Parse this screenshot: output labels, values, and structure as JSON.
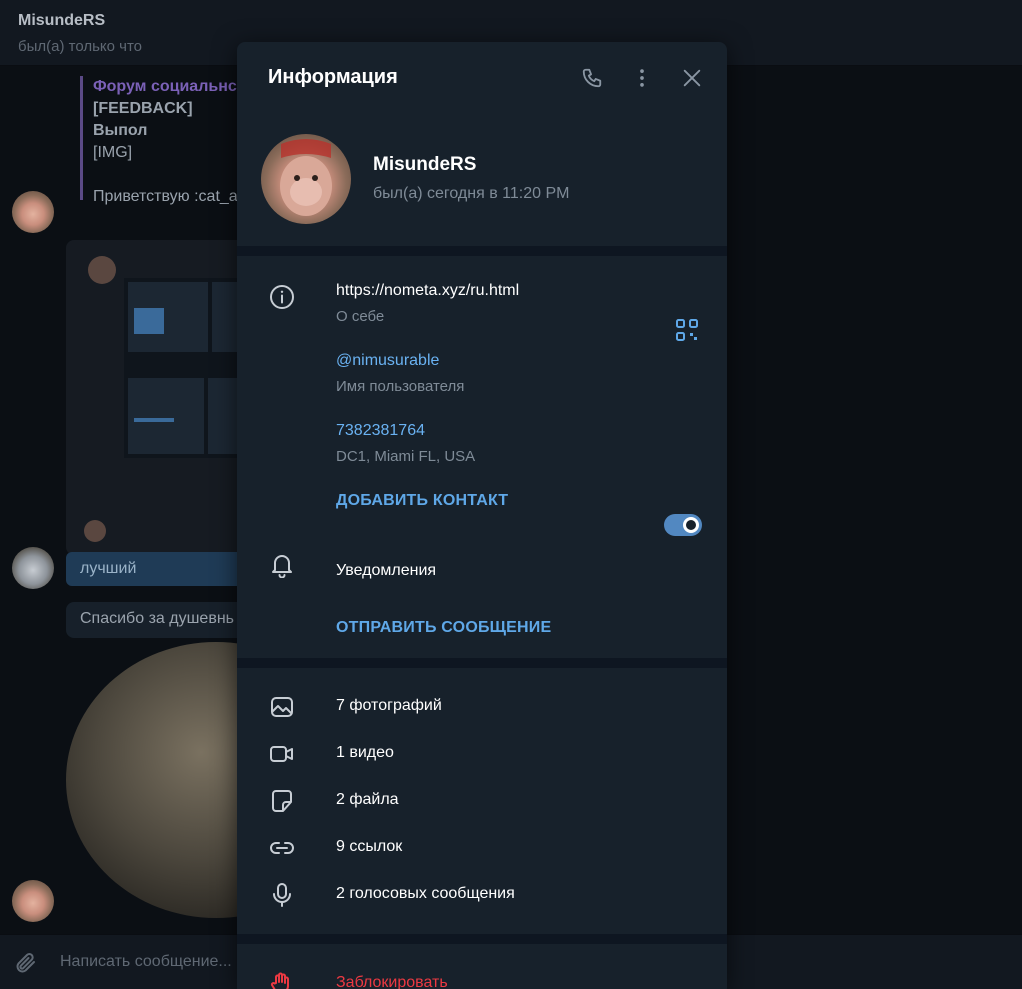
{
  "chat": {
    "title": "MisundeRS",
    "status": "был(а) только что",
    "quote_title": "Форум социальнс",
    "quote_line1": "[FEEDBACK] Выпол",
    "quote_line2": "[IMG]",
    "quote_line3": "Приветствую :cat_a",
    "msg_best": "лучший",
    "msg_thanks": "Спасибо за душевнь",
    "composer_placeholder": "Написать сообщение..."
  },
  "panel": {
    "title": "Информация",
    "header_icons": [
      "phone-icon",
      "more-vertical-icon",
      "close-icon"
    ],
    "profile": {
      "name": "MisundeRS",
      "status": "был(а) сегодня в 11:20 PM"
    },
    "info": {
      "bio_value": "https://nometa.xyz/ru.html",
      "bio_label": "О себе",
      "username_value": "@nimusurable",
      "username_label": "Имя пользователя",
      "phone_value": "7382381764",
      "phone_label": "DC1, Miami FL, USA",
      "add_contact": "ДОБАВИТЬ КОНТАКТ"
    },
    "notifications": {
      "label": "Уведомления",
      "enabled": true
    },
    "send_message": "ОТПРАВИТЬ СООБЩЕНИЕ",
    "media": [
      {
        "icon": "photo-icon",
        "label": "7 фотографий"
      },
      {
        "icon": "video-icon",
        "label": "1 видео"
      },
      {
        "icon": "file-icon",
        "label": "2 файла"
      },
      {
        "icon": "link-icon",
        "label": "9 ссылок"
      },
      {
        "icon": "microphone-icon",
        "label": "2 голосовых сообщения"
      }
    ],
    "block": "Заблокировать"
  },
  "colors": {
    "panel_bg": "#17212b",
    "accent": "#5fa8e8",
    "danger": "#ec3942",
    "toggle_on": "#5288c1"
  }
}
